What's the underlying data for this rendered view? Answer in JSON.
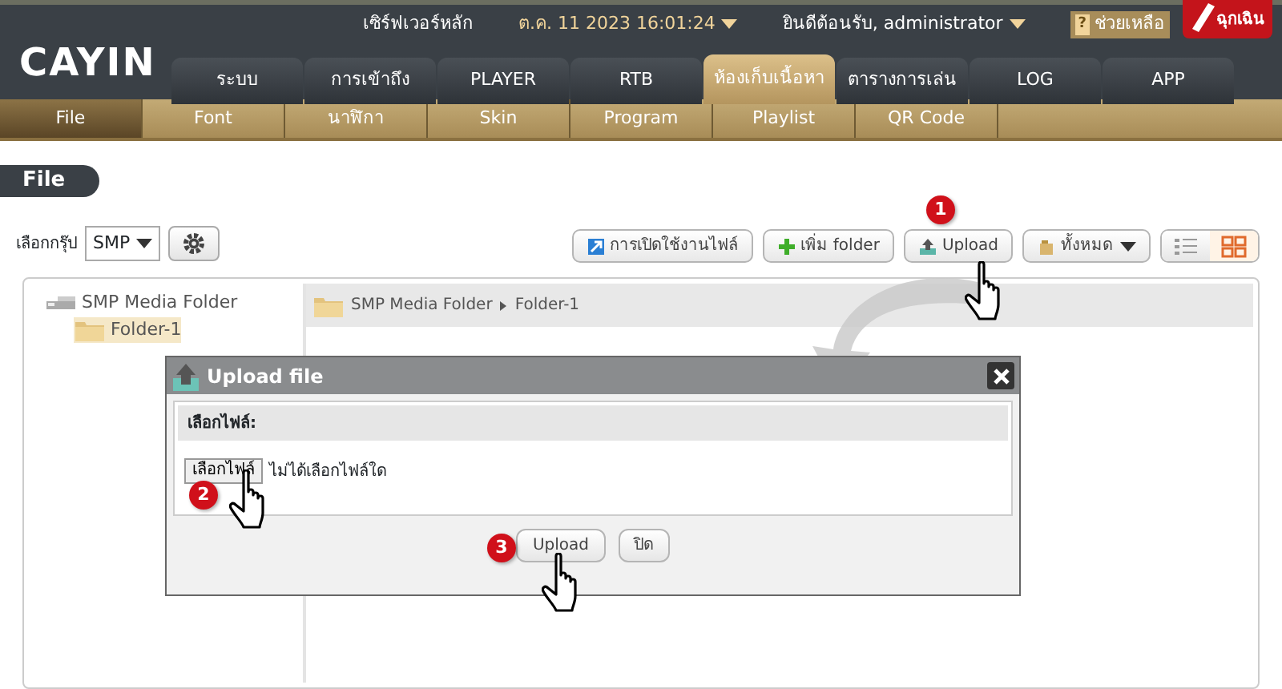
{
  "header": {
    "server": "เซิร์ฟเวอร์หลัก",
    "datetime": "ต.ค. 11 2023 16:01:24",
    "welcome": "ยินดีต้อนรับ, administrator",
    "help_icon": "?",
    "help": "ช่วยเหลือ",
    "emergency": "ฉุกเฉิน"
  },
  "logo": "CAYIN",
  "tabs": [
    {
      "label": "ระบบ",
      "selected": false
    },
    {
      "label": "การเข้าถึง",
      "selected": false
    },
    {
      "label": "PLAYER",
      "selected": false
    },
    {
      "label": "RTB",
      "selected": false
    },
    {
      "label": "ห้องเก็บเนื้อหา",
      "selected": true
    },
    {
      "label": "ตารางการเล่น",
      "selected": false
    },
    {
      "label": "LOG",
      "selected": false
    },
    {
      "label": "APP",
      "selected": false
    }
  ],
  "subtabs": [
    {
      "label": "File",
      "selected": true
    },
    {
      "label": "Font",
      "selected": false
    },
    {
      "label": "นาฬิกา",
      "selected": false
    },
    {
      "label": "Skin",
      "selected": false
    },
    {
      "label": "Program",
      "selected": false
    },
    {
      "label": "Playlist",
      "selected": false
    },
    {
      "label": "QR Code",
      "selected": false
    }
  ],
  "section_title": "File",
  "group": {
    "label": "เลือกกรุ๊ป",
    "value": "SMP"
  },
  "toolbar": [
    {
      "kind": "activate",
      "label": "การเปิดใช้งานไฟล์"
    },
    {
      "kind": "add",
      "label": "เพิ่ม folder"
    },
    {
      "kind": "upload",
      "label": "Upload"
    },
    {
      "kind": "filter",
      "label": "ทั้งหมด"
    }
  ],
  "view_modes": [
    {
      "kind": "list",
      "selected": false
    },
    {
      "kind": "grid",
      "selected": true
    }
  ],
  "tree": [
    {
      "label": "SMP Media Folder",
      "selected": false,
      "children": [
        {
          "label": "Folder-1",
          "selected": true
        }
      ]
    }
  ],
  "breadcrumb": [
    "SMP Media Folder",
    "Folder-1"
  ],
  "dialog": {
    "title": "Upload file",
    "section": "เลือกไฟล์:",
    "choose_button": "เลือกไฟล์",
    "no_file": "ไม่ได้เลือกไฟล์ใด",
    "buttons": [
      "Upload",
      "ปิด"
    ]
  },
  "callouts": [
    "1",
    "2",
    "3"
  ]
}
